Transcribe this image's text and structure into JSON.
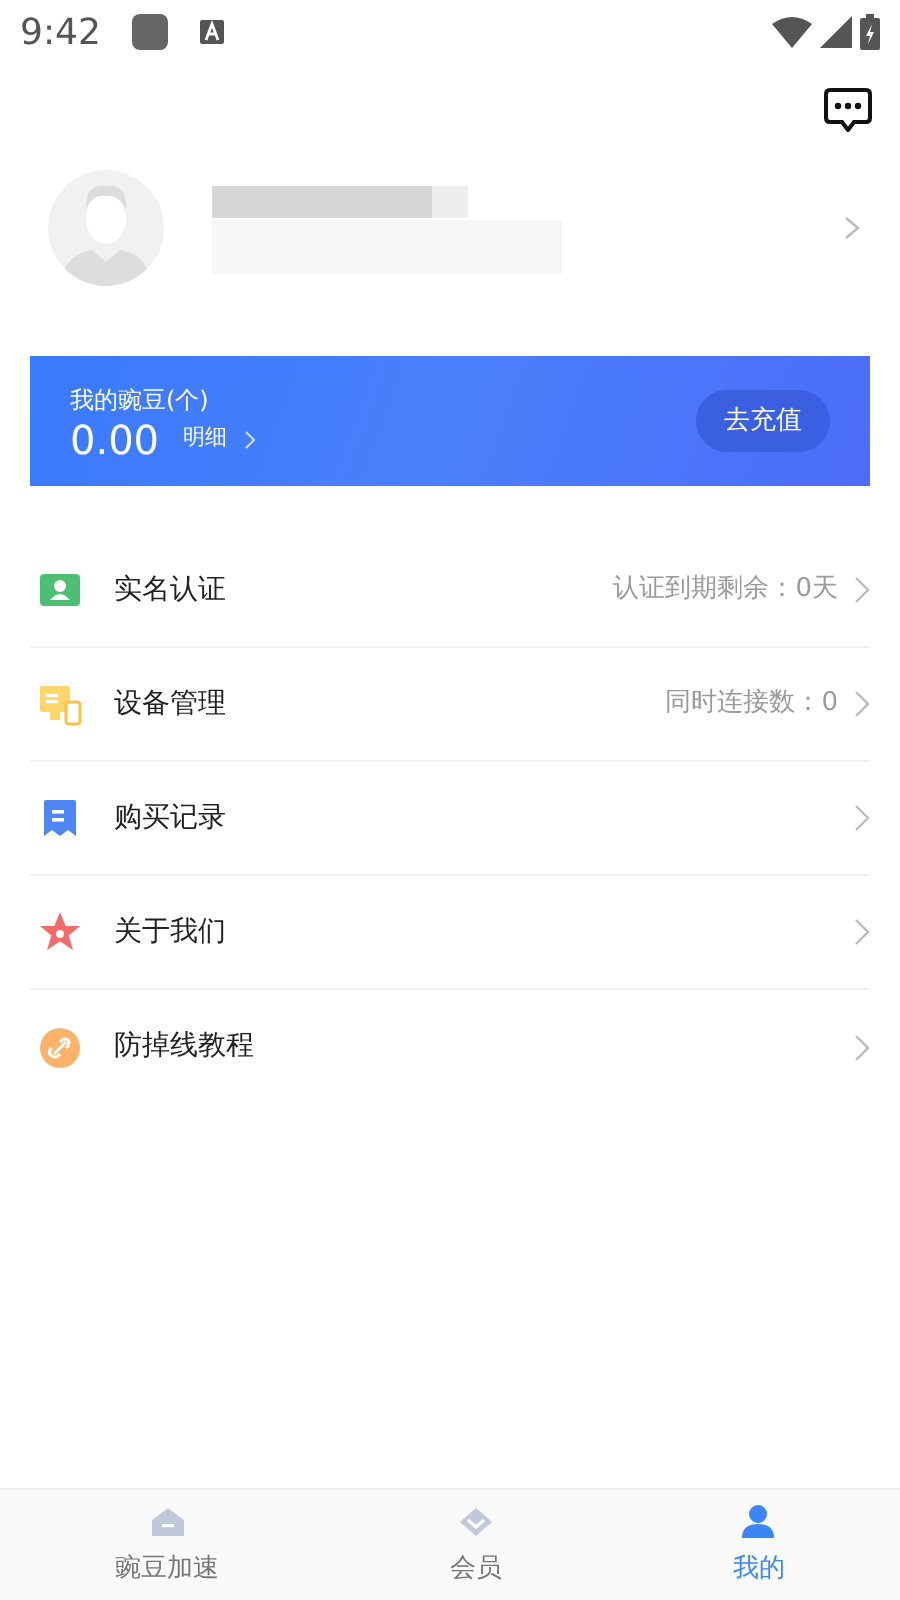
{
  "status_bar": {
    "time": "9:42"
  },
  "balance": {
    "label": "我的豌豆(个)",
    "amount": "0.00",
    "detail": "明细",
    "button": "去充值"
  },
  "menu": [
    {
      "kind": "id",
      "label": "实名认证",
      "value": "认证到期剩余：0天"
    },
    {
      "kind": "device",
      "label": "设备管理",
      "value": "同时连接数：0"
    },
    {
      "kind": "record",
      "label": "购买记录"
    },
    {
      "kind": "star",
      "label": "关于我们"
    },
    {
      "kind": "link",
      "label": "防掉线教程"
    }
  ],
  "tabs": [
    {
      "kind": "home",
      "label": "豌豆加速",
      "selected": false
    },
    {
      "kind": "vip",
      "label": "会员",
      "selected": false
    },
    {
      "kind": "me",
      "label": "我的",
      "selected": true
    }
  ]
}
